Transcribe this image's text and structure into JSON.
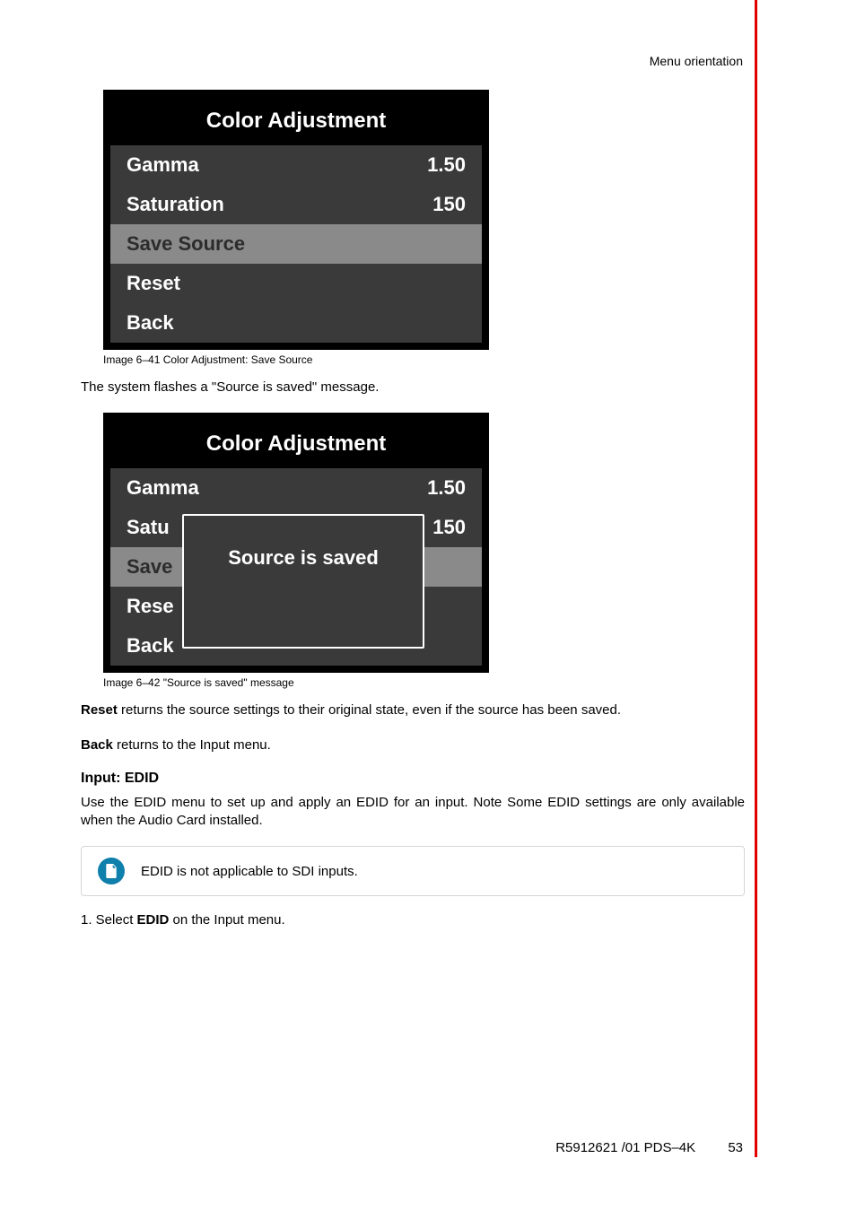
{
  "header": "Menu orientation",
  "menu1": {
    "title": "Color Adjustment",
    "rows": [
      {
        "label": "Gamma",
        "value": "1.50"
      },
      {
        "label": "Saturation",
        "value": "150"
      },
      {
        "label": "Save Source",
        "value": ""
      },
      {
        "label": "Reset",
        "value": ""
      },
      {
        "label": "Back",
        "value": ""
      }
    ],
    "caption": "Image 6–41  Color Adjustment: Save Source"
  },
  "para1": "The system flashes a \"Source is saved\" message.",
  "menu2": {
    "title": "Color Adjustment",
    "rows": [
      {
        "label": "Gamma",
        "value": "1.50"
      },
      {
        "label_cut": "Satu",
        "value": "150"
      },
      {
        "label_cut": "Save",
        "value": ""
      },
      {
        "label_cut": "Rese",
        "value": ""
      },
      {
        "label": "Back",
        "value": ""
      }
    ],
    "overlay": "Source is saved",
    "caption": "Image 6–42  \"Source is saved\" message"
  },
  "para2_bold": "Reset",
  "para2_rest": " returns the source settings to their original state, even if the source has been saved.",
  "para3_bold": "Back",
  "para3_rest": " returns to the Input menu.",
  "heading": "Input: EDID",
  "para4": "Use the EDID menu to set up and apply an EDID for an input. Note Some EDID settings are only available when the Audio Card installed.",
  "note": "EDID is not applicable to SDI inputs.",
  "step_prefix": "1.   Select ",
  "step_bold": "EDID",
  "step_suffix": " on the Input menu.",
  "footer_doc": "R5912621 /01 PDS–4K",
  "footer_page": "53"
}
